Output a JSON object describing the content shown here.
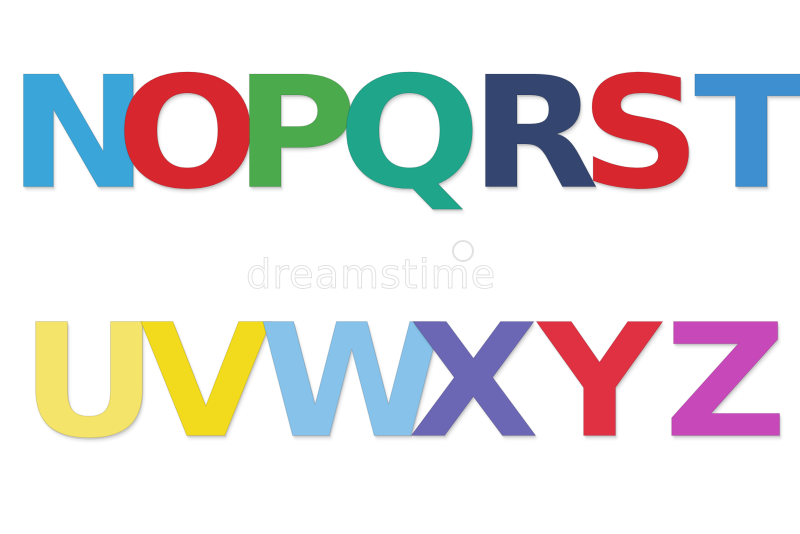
{
  "photo": {
    "background": "#ffffff",
    "rows": [
      {
        "letters": [
          {
            "char": "N",
            "color": "#3aa5d8"
          },
          {
            "char": "O",
            "color": "#d8262e"
          },
          {
            "char": "P",
            "color": "#4bab4c"
          },
          {
            "char": "Q",
            "color": "#1fa58a"
          },
          {
            "char": "R",
            "color": "#34466f"
          },
          {
            "char": "S",
            "color": "#d8262e"
          },
          {
            "char": "T",
            "color": "#3d8fd0"
          }
        ]
      },
      {
        "letters": [
          {
            "char": "U",
            "color": "#f5e46a"
          },
          {
            "char": "V",
            "color": "#f2da1c"
          },
          {
            "char": "W",
            "color": "#86c2ea"
          },
          {
            "char": "X",
            "color": "#6c67b4"
          },
          {
            "char": "Y",
            "color": "#df3142"
          },
          {
            "char": "Z",
            "color": "#c748b9"
          }
        ]
      }
    ],
    "watermark": "dreamstime"
  }
}
